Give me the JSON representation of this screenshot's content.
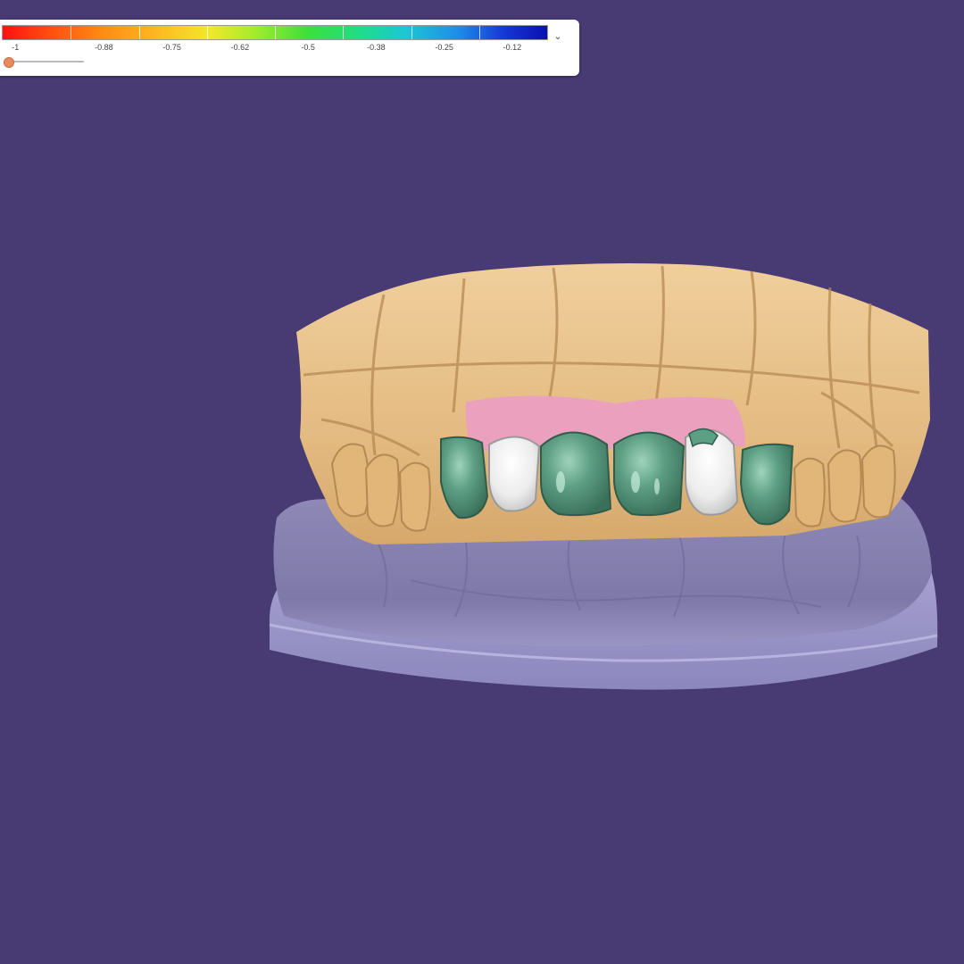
{
  "viewport": {
    "background_color": "#483a72"
  },
  "legend": {
    "ticks": [
      "-1",
      "-0.88",
      "-0.75",
      "-0.62",
      "-0.5",
      "-0.38",
      "-0.25",
      "-0.12"
    ],
    "gradient_colors": [
      "#ff1010",
      "#ff8a12",
      "#f2e82a",
      "#3ce03a",
      "#1ec6d6",
      "#1e8ae8",
      "#0a10b0"
    ],
    "collapse_icon": "chevron-down-icon",
    "slider": {
      "name": "threshold-slider",
      "value_fraction": 0.0,
      "thumb_color": "#e88a5e"
    }
  },
  "model": {
    "upper_cast_color": "#e9c38d",
    "lower_cast_color": "#8f89b8",
    "gingiva_color": "#eba1bd",
    "crown_color": "#5d9f84",
    "prepared_tooth_color": "#f1f1f1"
  }
}
